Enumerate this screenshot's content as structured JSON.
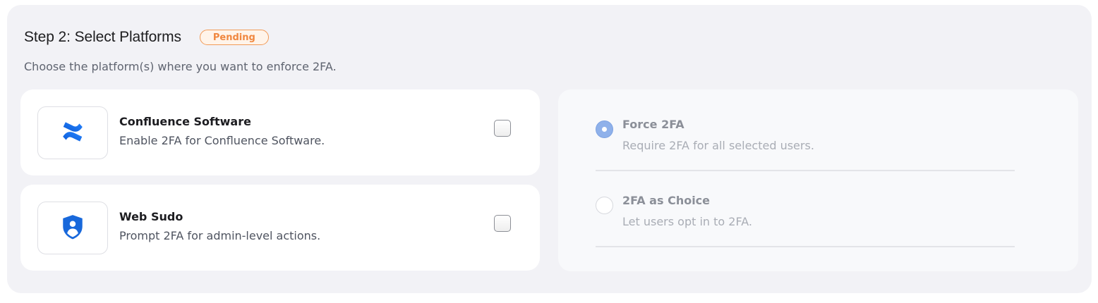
{
  "step": {
    "title": "Step 2: Select Platforms",
    "status_badge": "Pending",
    "subtitle": "Choose the platform(s) where you want to enforce 2FA."
  },
  "platforms": [
    {
      "name": "Confluence Software",
      "description": "Enable 2FA for Confluence Software.",
      "icon": "confluence-logo-icon",
      "checked": false
    },
    {
      "name": "Web Sudo",
      "description": "Prompt 2FA for admin-level actions.",
      "icon": "user-shield-icon",
      "checked": false
    }
  ],
  "enforcement_options": [
    {
      "label": "Force 2FA",
      "description": "Require 2FA for all selected users.",
      "selected": true
    },
    {
      "label": "2FA as Choice",
      "description": "Let users opt in to 2FA.",
      "selected": false
    }
  ],
  "colors": {
    "badge_orange": "#f0873f",
    "brand_blue": "#1868db",
    "radio_selected": "#8fb1ea"
  }
}
